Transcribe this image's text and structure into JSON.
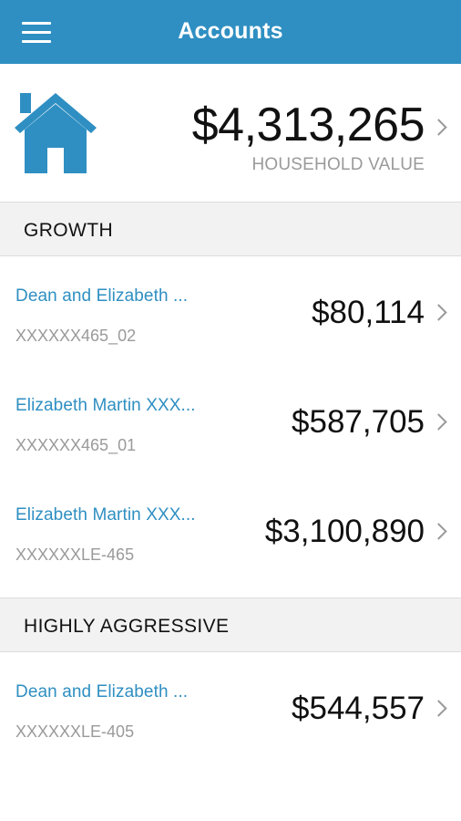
{
  "header": {
    "title": "Accounts"
  },
  "household": {
    "value": "$4,313,265",
    "label": "HOUSEHOLD VALUE"
  },
  "sections": [
    {
      "title": "GROWTH",
      "accounts": [
        {
          "name": "Dean and Elizabeth ...",
          "number": "XXXXXX465_02",
          "value": "$80,114"
        },
        {
          "name": "Elizabeth Martin XXX...",
          "number": "XXXXXX465_01",
          "value": "$587,705"
        },
        {
          "name": "Elizabeth Martin XXX...",
          "number": "XXXXXXLE-465",
          "value": "$3,100,890"
        }
      ]
    },
    {
      "title": "HIGHLY AGGRESSIVE",
      "accounts": [
        {
          "name": "Dean and Elizabeth ...",
          "number": "XXXXXXLE-405",
          "value": "$544,557"
        }
      ]
    }
  ],
  "colors": {
    "accent": "#2f8fc2",
    "section_bg": "#f2f2f2",
    "muted_text": "#9a9a9a"
  }
}
